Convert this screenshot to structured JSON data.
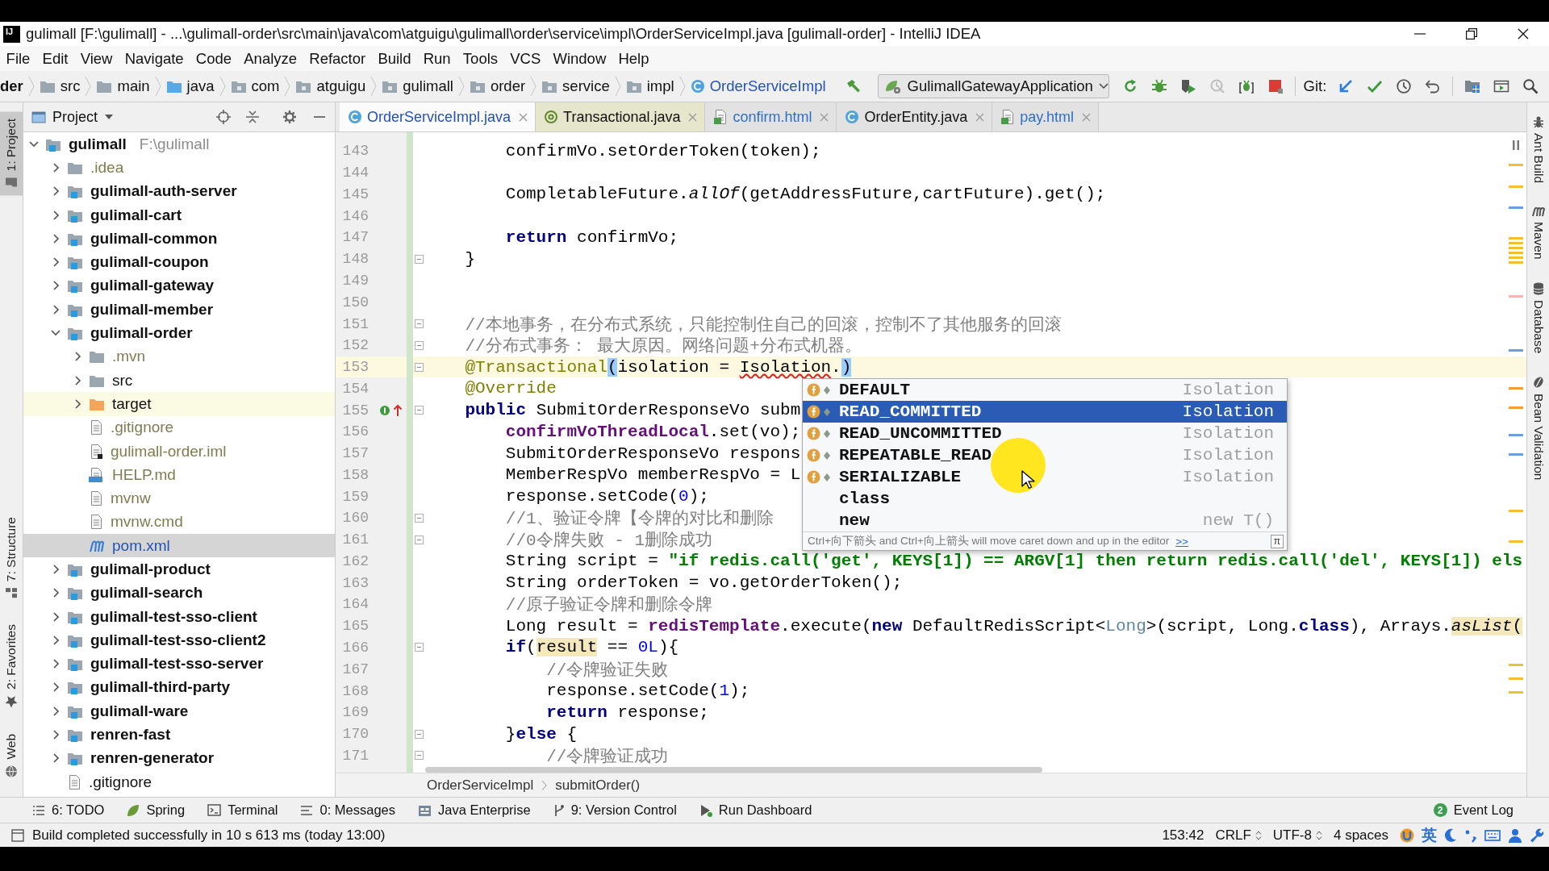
{
  "window": {
    "logo": "IJ",
    "title": "gulimall [F:\\gulimall] - ...\\gulimall-order\\src\\main\\java\\com\\atguigu\\gulimall\\order\\service\\impl\\OrderServiceImpl.java [gulimall-order] - IntelliJ IDEA"
  },
  "menu": [
    "File",
    "Edit",
    "View",
    "Navigate",
    "Code",
    "Analyze",
    "Refactor",
    "Build",
    "Run",
    "Tools",
    "VCS",
    "Window",
    "Help"
  ],
  "navigation": {
    "breadcrumbs": [
      {
        "label": "der",
        "kind": "module"
      },
      {
        "label": "src",
        "kind": "folder"
      },
      {
        "label": "main",
        "kind": "folder"
      },
      {
        "label": "java",
        "kind": "source-folder"
      },
      {
        "label": "com",
        "kind": "package"
      },
      {
        "label": "atguigu",
        "kind": "package"
      },
      {
        "label": "gulimall",
        "kind": "package"
      },
      {
        "label": "order",
        "kind": "package"
      },
      {
        "label": "service",
        "kind": "package"
      },
      {
        "label": "impl",
        "kind": "package"
      },
      {
        "label": "OrderServiceImpl",
        "kind": "class",
        "color": "#2452b8"
      }
    ],
    "run_configuration": "GulimallGatewayApplication",
    "vcs_label": "Git:"
  },
  "left_stripe": [
    {
      "label": "1: Project",
      "kind": "project",
      "selected": true
    },
    {
      "label": "7: Structure",
      "kind": "structure",
      "selected": false
    },
    {
      "label": "2: Favorites",
      "kind": "favorites",
      "selected": false
    },
    {
      "label": "Web",
      "kind": "web",
      "selected": false
    }
  ],
  "project_panel": {
    "title": "Project",
    "tree": [
      {
        "label": "gulimall",
        "path": "F:\\gulimall",
        "kind": "module",
        "expanded": true,
        "selected": false,
        "children": [
          {
            "label": ".idea",
            "kind": "folder",
            "expanded": false,
            "selected": false,
            "color": "#7d7d50"
          },
          {
            "label": "gulimall-auth-server",
            "kind": "module",
            "expanded": false,
            "selected": false
          },
          {
            "label": "gulimall-cart",
            "kind": "module",
            "expanded": false,
            "selected": false
          },
          {
            "label": "gulimall-common",
            "kind": "module",
            "expanded": false,
            "selected": false
          },
          {
            "label": "gulimall-coupon",
            "kind": "module",
            "expanded": false,
            "selected": false
          },
          {
            "label": "gulimall-gateway",
            "kind": "module",
            "expanded": false,
            "selected": false
          },
          {
            "label": "gulimall-member",
            "kind": "module",
            "expanded": false,
            "selected": false
          },
          {
            "label": "gulimall-order",
            "kind": "module",
            "expanded": true,
            "selected": false,
            "children": [
              {
                "label": ".mvn",
                "kind": "folder",
                "expanded": false,
                "selected": false,
                "color": "#7d7d50"
              },
              {
                "label": "src",
                "kind": "folder",
                "expanded": false,
                "selected": false
              },
              {
                "label": "target",
                "kind": "excluded-folder",
                "expanded": false,
                "selected": false
              },
              {
                "label": ".gitignore",
                "kind": "text-file",
                "selected": false,
                "color": "#7d7d50"
              },
              {
                "label": "gulimall-order.iml",
                "kind": "iml-file",
                "selected": false,
                "color": "#7d7d50"
              },
              {
                "label": "HELP.md",
                "kind": "md-file",
                "selected": false,
                "color": "#7d7d50"
              },
              {
                "label": "mvnw",
                "kind": "text-file",
                "selected": false,
                "color": "#7d7d50"
              },
              {
                "label": "mvnw.cmd",
                "kind": "text-file",
                "selected": false,
                "color": "#7d7d50"
              },
              {
                "label": "pom.xml",
                "kind": "maven-file",
                "selected": true,
                "color": "#2452b8"
              }
            ]
          },
          {
            "label": "gulimall-product",
            "kind": "module",
            "expanded": false,
            "selected": false
          },
          {
            "label": "gulimall-search",
            "kind": "module",
            "expanded": false,
            "selected": false
          },
          {
            "label": "gulimall-test-sso-client",
            "kind": "module",
            "expanded": false,
            "selected": false
          },
          {
            "label": "gulimall-test-sso-client2",
            "kind": "module",
            "expanded": false,
            "selected": false
          },
          {
            "label": "gulimall-test-sso-server",
            "kind": "module",
            "expanded": false,
            "selected": false
          },
          {
            "label": "gulimall-third-party",
            "kind": "module",
            "expanded": false,
            "selected": false
          },
          {
            "label": "gulimall-ware",
            "kind": "module",
            "expanded": false,
            "selected": false
          },
          {
            "label": "renren-fast",
            "kind": "module",
            "expanded": false,
            "selected": false
          },
          {
            "label": "renren-generator",
            "kind": "module",
            "expanded": false,
            "selected": false
          },
          {
            "label": ".gitignore",
            "kind": "text-file",
            "selected": false
          }
        ]
      }
    ]
  },
  "editor": {
    "tabs": [
      {
        "label": "OrderServiceImpl.java",
        "kind": "class",
        "selected": true,
        "library": false,
        "color": "#2452b8"
      },
      {
        "label": "Transactional.java",
        "kind": "annotation",
        "selected": false,
        "library": true
      },
      {
        "label": "confirm.html",
        "kind": "html",
        "selected": false,
        "library": false,
        "color": "#2f6fc9"
      },
      {
        "label": "OrderEntity.java",
        "kind": "class",
        "selected": false,
        "library": false
      },
      {
        "label": "pay.html",
        "kind": "html",
        "selected": false,
        "library": false,
        "color": "#2f6fc9"
      }
    ],
    "lines": [
      {
        "number": "143",
        "kind": "plain",
        "current": false,
        "fold": false,
        "tokens": [
          "        confirmVo.setOrderToken(token);"
        ]
      },
      {
        "number": "144",
        "kind": "plain",
        "current": false,
        "fold": false
      },
      {
        "number": "145",
        "kind": "plain",
        "current": false,
        "fold": false,
        "tokens": [
          "        CompletableFuture.",
          {
            "text": "allOf",
            "kind": "static"
          },
          "(getAddressFuture,cartFuture).get();"
        ]
      },
      {
        "number": "146",
        "kind": "plain",
        "current": false,
        "fold": false
      },
      {
        "number": "147",
        "kind": "plain",
        "current": false,
        "fold": false,
        "tokens": [
          {
            "text": "        return",
            "kind": "keyword"
          },
          " confirmVo;"
        ]
      },
      {
        "number": "148",
        "kind": "plain",
        "current": false,
        "fold": true,
        "tokens": [
          "    }"
        ]
      },
      {
        "number": "149",
        "kind": "plain",
        "current": false,
        "fold": false
      },
      {
        "number": "150",
        "kind": "plain",
        "current": false,
        "fold": false
      },
      {
        "number": "151",
        "kind": "plain",
        "current": false,
        "fold": true,
        "tokens": [
          {
            "text": "    //本地事务，在分布式系统，只能控制住自己的回滚，控制不了其他服务的回滚",
            "kind": "comment"
          }
        ]
      },
      {
        "number": "152",
        "kind": "plain",
        "current": false,
        "fold": true,
        "tokens": [
          {
            "text": "    //分布式事务： 最大原因。网络问题+分布式机器。",
            "kind": "comment"
          }
        ]
      },
      {
        "number": "153",
        "kind": "plain",
        "current": true,
        "fold": true,
        "tokens": [
          {
            "text": "    @Transactional",
            "kind": "annotation"
          },
          {
            "text": "(",
            "kind": "brace"
          },
          "isolation = ",
          {
            "text": "Isolation",
            "kind": "error"
          },
          ".",
          {
            "text": ")",
            "kind": "brace"
          }
        ]
      },
      {
        "number": "154",
        "kind": "plain",
        "current": false,
        "fold": false,
        "tokens": [
          {
            "text": "    @Override",
            "kind": "annotation"
          }
        ]
      },
      {
        "number": "155",
        "kind": "implementing",
        "current": false,
        "fold": true,
        "tokens": [
          {
            "text": "    public",
            "kind": "keyword"
          },
          " SubmitOrderResponseVo subm"
        ]
      },
      {
        "number": "156",
        "kind": "plain",
        "current": false,
        "fold": false,
        "tokens": [
          {
            "text": "        confirmVoThreadLocal",
            "kind": "field"
          },
          ".set(vo);"
        ]
      },
      {
        "number": "157",
        "kind": "plain",
        "current": false,
        "fold": false,
        "tokens": [
          "        SubmitOrderResponseVo respons"
        ]
      },
      {
        "number": "158",
        "kind": "plain",
        "current": false,
        "fold": false,
        "tokens": [
          "        MemberRespVo memberRespVo = L"
        ]
      },
      {
        "number": "159",
        "kind": "plain",
        "current": false,
        "fold": false,
        "tokens": [
          "        response.setCode(",
          {
            "text": "0",
            "kind": "number"
          },
          ");"
        ]
      },
      {
        "number": "160",
        "kind": "plain",
        "current": false,
        "fold": true,
        "tokens": [
          {
            "text": "        //1、验证令牌【令牌的对比和删除",
            "kind": "comment"
          }
        ]
      },
      {
        "number": "161",
        "kind": "plain",
        "current": false,
        "fold": true,
        "tokens": [
          {
            "text": "        //0令牌失败 - 1删除成功",
            "kind": "comment"
          }
        ]
      },
      {
        "number": "162",
        "kind": "plain",
        "current": false,
        "fold": false,
        "tokens": [
          "        String script = ",
          {
            "text": "\"if redis.call('get', KEYS[1]) == ARGV[1] then return redis.call('del', KEYS[1]) els",
            "kind": "string"
          }
        ]
      },
      {
        "number": "163",
        "kind": "plain",
        "current": false,
        "fold": false,
        "tokens": [
          "        String orderToken = vo.getOrderToken();"
        ]
      },
      {
        "number": "164",
        "kind": "plain",
        "current": false,
        "fold": false,
        "tokens": [
          {
            "text": "        //原子验证令牌和删除令牌",
            "kind": "comment"
          }
        ]
      },
      {
        "number": "165",
        "kind": "plain",
        "current": false,
        "fold": false,
        "tokens": [
          "        Long result = ",
          {
            "text": "redisTemplate",
            "kind": "field"
          },
          ".execute(",
          {
            "text": "new",
            "kind": "keyword"
          },
          " DefaultRedisScript<",
          {
            "text": "Long",
            "kind": "type-argument"
          },
          ">(script, Long.",
          {
            "text": "class",
            "kind": "keyword"
          },
          "), Arrays.",
          {
            "text": "asList",
            "kind": "static-usage"
          },
          {
            "text": "(",
            "kind": "usage"
          }
        ]
      },
      {
        "number": "166",
        "kind": "plain",
        "current": false,
        "fold": true,
        "tokens": [
          {
            "text": "        if",
            "kind": "keyword"
          },
          "(",
          {
            "text": "result",
            "kind": "usage"
          },
          " == ",
          {
            "text": "0L",
            "kind": "number"
          },
          "){"
        ]
      },
      {
        "number": "167",
        "kind": "plain",
        "current": false,
        "fold": false,
        "tokens": [
          {
            "text": "            //令牌验证失败",
            "kind": "comment"
          }
        ]
      },
      {
        "number": "168",
        "kind": "plain",
        "current": false,
        "fold": false,
        "tokens": [
          "            response.setCode(",
          {
            "text": "1",
            "kind": "number"
          },
          ");"
        ]
      },
      {
        "number": "169",
        "kind": "plain",
        "current": false,
        "fold": false,
        "tokens": [
          {
            "text": "            return",
            "kind": "keyword"
          },
          " response;"
        ]
      },
      {
        "number": "170",
        "kind": "plain",
        "current": false,
        "fold": true,
        "tokens": [
          "        }",
          {
            "text": "else",
            "kind": "keyword"
          },
          " {"
        ]
      },
      {
        "number": "171",
        "kind": "plain",
        "current": false,
        "fold": true,
        "tokens": [
          {
            "text": "            //令牌验证成功",
            "kind": "comment"
          }
        ]
      }
    ],
    "completion": {
      "items": [
        {
          "name": "DEFAULT",
          "type": "Isolation",
          "kind": "field",
          "selected": false
        },
        {
          "name": "READ_COMMITTED",
          "type": "Isolation",
          "kind": "field",
          "selected": true
        },
        {
          "name": "READ_UNCOMMITTED",
          "type": "Isolation",
          "kind": "field",
          "selected": false
        },
        {
          "name": "REPEATABLE_READ",
          "type": "Isolation",
          "kind": "field",
          "selected": false
        },
        {
          "name": "SERIALIZABLE",
          "type": "Isolation",
          "kind": "field",
          "selected": false
        },
        {
          "name": "class",
          "kind": "keyword",
          "selected": false
        },
        {
          "name": "new",
          "type": "new T()",
          "kind": "keyword",
          "selected": false
        }
      ],
      "hint": "Ctrl+向下箭头 and Ctrl+向上箭头 will move caret down and up in the editor",
      "hint_link": ">>",
      "pin": "π"
    },
    "breadcrumbs": [
      "OrderServiceImpl",
      "submitOrder()"
    ]
  },
  "right_stripe": [
    {
      "label": "Ant Build",
      "kind": "ant"
    },
    {
      "label": "Maven",
      "kind": "maven"
    },
    {
      "label": "Database",
      "kind": "database"
    },
    {
      "label": "Bean Validation",
      "kind": "bean"
    }
  ],
  "tool_windows": [
    {
      "label": "6: TODO",
      "kind": "todo"
    },
    {
      "label": "Spring",
      "kind": "spring"
    },
    {
      "label": "Terminal",
      "kind": "terminal"
    },
    {
      "label": "0: Messages",
      "kind": "messages"
    },
    {
      "label": "Java Enterprise",
      "kind": "java-enterprise"
    },
    {
      "label": "9: Version Control",
      "kind": "version-control"
    },
    {
      "label": "Run Dashboard",
      "kind": "run-dashboard"
    }
  ],
  "event_log": {
    "label": "Event Log",
    "count": "2"
  },
  "status_bar": {
    "message": "Build completed successfully in 10 s 613 ms (today 13:00)",
    "caret_position": "153:42",
    "line_separator": "CRLF",
    "encoding": "UTF-8",
    "indent": "4 spaces",
    "input_mode": "英"
  }
}
